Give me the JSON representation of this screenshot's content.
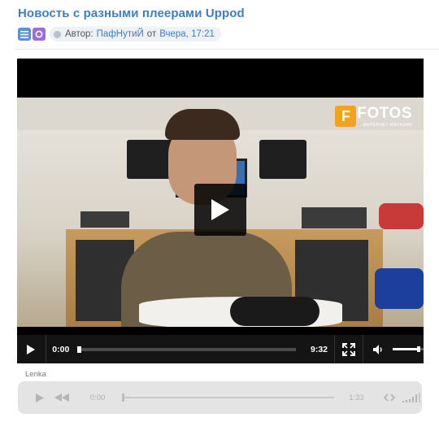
{
  "post": {
    "title": "Новость с разными плеерами Uppod",
    "author_prefix": "Автор:",
    "author": "ПафНутиЙ",
    "date_prefix": "от",
    "date": "Вчера, 17:21"
  },
  "video_player": {
    "watermark_brand": "FOTOS",
    "watermark_sub": "ИНТЕРНЕТ-МАГАЗИН",
    "current_time": "0:00",
    "duration": "9:32",
    "progress_fraction": 0.0,
    "volume_fraction": 0.85,
    "icons": [
      "big-play-icon",
      "play-icon",
      "fullscreen-icon",
      "volume-icon"
    ]
  },
  "audio_player": {
    "track_name": "Lenka",
    "current_time": "0:00",
    "duration": "1:33",
    "progress_fraction": 0.0,
    "icons": [
      "play-icon",
      "rewind-icon",
      "embed-code-icon",
      "volume-bars-icon"
    ]
  },
  "colors": {
    "title": "#3d7ec7",
    "player_bg": "#000000",
    "controls_bg": "#141414",
    "audio_bg": "#e4e4e4",
    "logo_accent": "#f3a21e"
  }
}
